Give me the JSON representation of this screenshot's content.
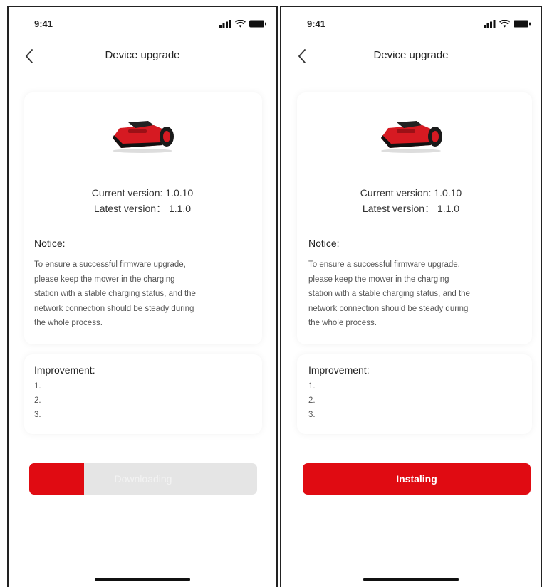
{
  "screens": [
    {
      "status": {
        "time": "9:41"
      },
      "nav": {
        "title": "Device upgrade",
        "back_icon": "chevron-left-icon"
      },
      "device": {
        "image": "robot-mower",
        "current_version": "Current version: 1.0.10",
        "latest_version": "Latest version： 1.1.0"
      },
      "notice": {
        "title": "Notice:",
        "lines": [
          "To ensure a successful firmware upgrade,",
          "please keep the mower in the charging",
          "station with a stable charging status, and the",
          "network connection should be steady during",
          "the whole process."
        ]
      },
      "improvement": {
        "title": "Improvement:",
        "items": [
          "1.",
          "2.",
          "3."
        ]
      },
      "action": {
        "type": "progress",
        "label": "Downloading",
        "progress": 0.24
      }
    },
    {
      "status": {
        "time": "9:41"
      },
      "nav": {
        "title": "Device upgrade",
        "back_icon": "chevron-left-icon"
      },
      "device": {
        "image": "robot-mower",
        "current_version": "Current version: 1.0.10",
        "latest_version": "Latest version： 1.1.0"
      },
      "notice": {
        "title": "Notice:",
        "lines": [
          "To ensure a successful firmware upgrade,",
          "please keep the mower in the charging",
          "station with a stable charging status, and the",
          "network connection should be steady during",
          "the whole process."
        ]
      },
      "improvement": {
        "title": "Improvement:",
        "items": [
          "1.",
          "2.",
          "3."
        ]
      },
      "action": {
        "type": "button",
        "label": "Instaling"
      }
    }
  ],
  "colors": {
    "accent": "#e00b12",
    "progress_track": "#e5e5e5",
    "text": "#333333"
  }
}
